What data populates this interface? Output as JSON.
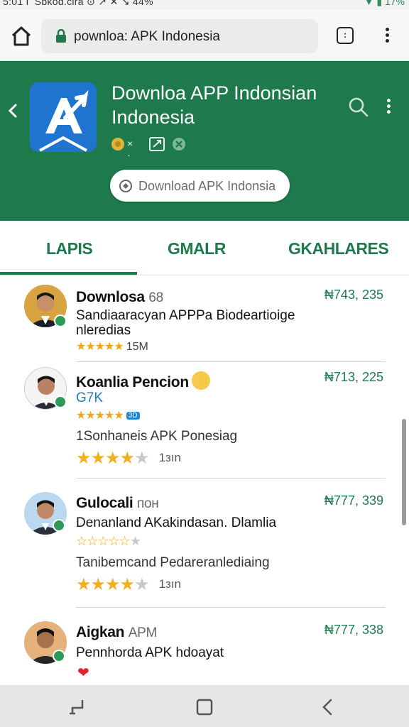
{
  "status_bar": {
    "left_text": "5:01 Г Sbkоd.cira ⊙ ↗ ✕ ↘ 44%",
    "right_text": "▼ ▮ 17%"
  },
  "browser": {
    "url": "pownloa: APK Indonesia",
    "tabs_count": ":"
  },
  "app": {
    "title": "Downloa APP Indonsian Indonesia",
    "meta_text": "× ·",
    "download_label": "Download APK Indonsia"
  },
  "tabs": [
    {
      "label": "LAPIS",
      "active": true
    },
    {
      "label": "GMALR",
      "active": false
    },
    {
      "label": "GKAHLARES",
      "active": false
    }
  ],
  "items": [
    {
      "name": "Downlosa",
      "name_suffix": "68",
      "desc_line1": "Sandiaaracyan APPPa Biodeartioige",
      "desc_line2": "nleredias",
      "stars": "★★★★★",
      "count": "15M",
      "price": "₦743, 235"
    },
    {
      "name": "Koanlia Pencion",
      "sub_blue": "G7K",
      "stars_small": "★★★★★",
      "mini_badge": "3D",
      "desc2": "1Sonhaneis  APK Ponesiag",
      "stars_big_on": "★★★★",
      "stars_big_off": "★",
      "count": "1зın",
      "price": "₦713, 225"
    },
    {
      "name": "Gulocali",
      "name_suffix": "пон",
      "desc_line1": "Denanland AKakindasan. Dlamlia",
      "stars_small": "☆☆☆☆☆",
      "stars_small_off": "★",
      "desc2": "Tanibemcand Pedareranlediaing",
      "stars_big_on": "★★★★",
      "stars_big_off": "★",
      "count": "1зın",
      "price": "₦777, 339"
    },
    {
      "name": "Aigkan",
      "name_suffix": "APM",
      "desc_line1": "Pennhorda APK hdoayat",
      "stars_small": "★★★★★",
      "heart": "❤",
      "price": "₦777, 338"
    }
  ],
  "colors": {
    "brand_green": "#1e7a4c",
    "star_gold": "#f2b01e",
    "app_icon_blue": "#1f74cf"
  },
  "icons": [
    "home-icon",
    "lock-icon",
    "tabs-icon",
    "more-vert-icon",
    "back-icon",
    "search-icon",
    "shield-icon",
    "recent-apps-icon",
    "nav-home-icon",
    "nav-back-icon"
  ]
}
